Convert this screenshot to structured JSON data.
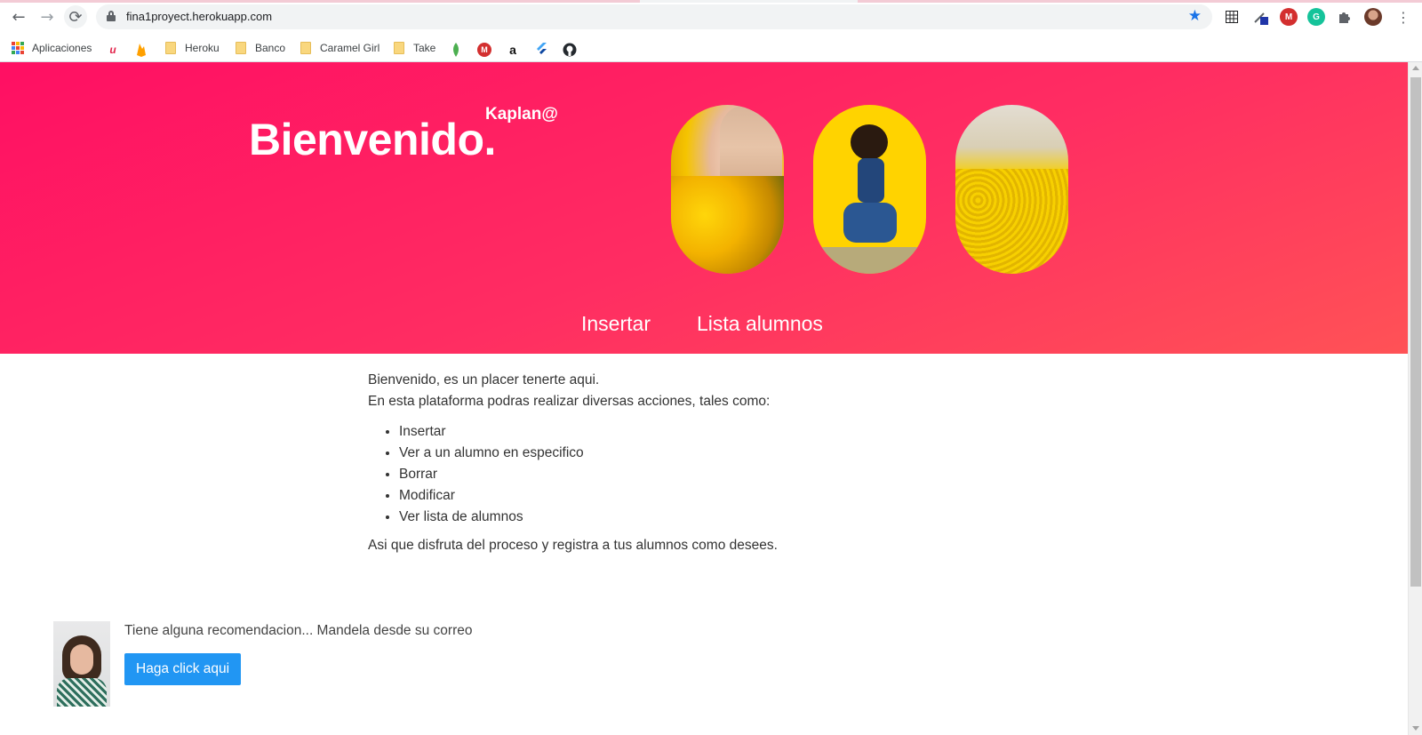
{
  "browser": {
    "url": "fina1proyect.herokuapp.com",
    "nav": {
      "back": "←",
      "forward": "→",
      "reload": "⟳"
    },
    "bookmarks": [
      {
        "label": "Aplicaciones",
        "icon": "apps-grid-icon"
      },
      {
        "label": "Heroku",
        "icon": "folder-icon"
      },
      {
        "label": "Banco",
        "icon": "folder-icon"
      },
      {
        "label": "Caramel Girl",
        "icon": "folder-icon"
      },
      {
        "label": "Take",
        "icon": "folder-icon"
      }
    ],
    "colors": {
      "star": "#1a73e8"
    }
  },
  "hero": {
    "title": "Bienvenido.",
    "username": "Kaplan@",
    "nav": [
      "Insertar",
      "Lista alumnos"
    ],
    "colors": {
      "gradient_start": "#ff0f63",
      "gradient_end": "#ff5256"
    }
  },
  "content": {
    "intro_1": "Bienvenido, es un placer tenerte aqui.",
    "intro_2": "En esta plataforma podras realizar diversas acciones, tales como:",
    "actions": [
      "Insertar",
      "Ver a un alumno en especifico",
      "Borrar",
      "Modificar",
      "Ver lista de alumnos"
    ],
    "outro": "Asi que disfruta del proceso y registra a tus alumnos como desees."
  },
  "footer": {
    "text": "Tiene alguna recomendacion... Mandela desde su correo",
    "button": "Haga click aqui",
    "colors": {
      "button": "#2196f3"
    }
  }
}
